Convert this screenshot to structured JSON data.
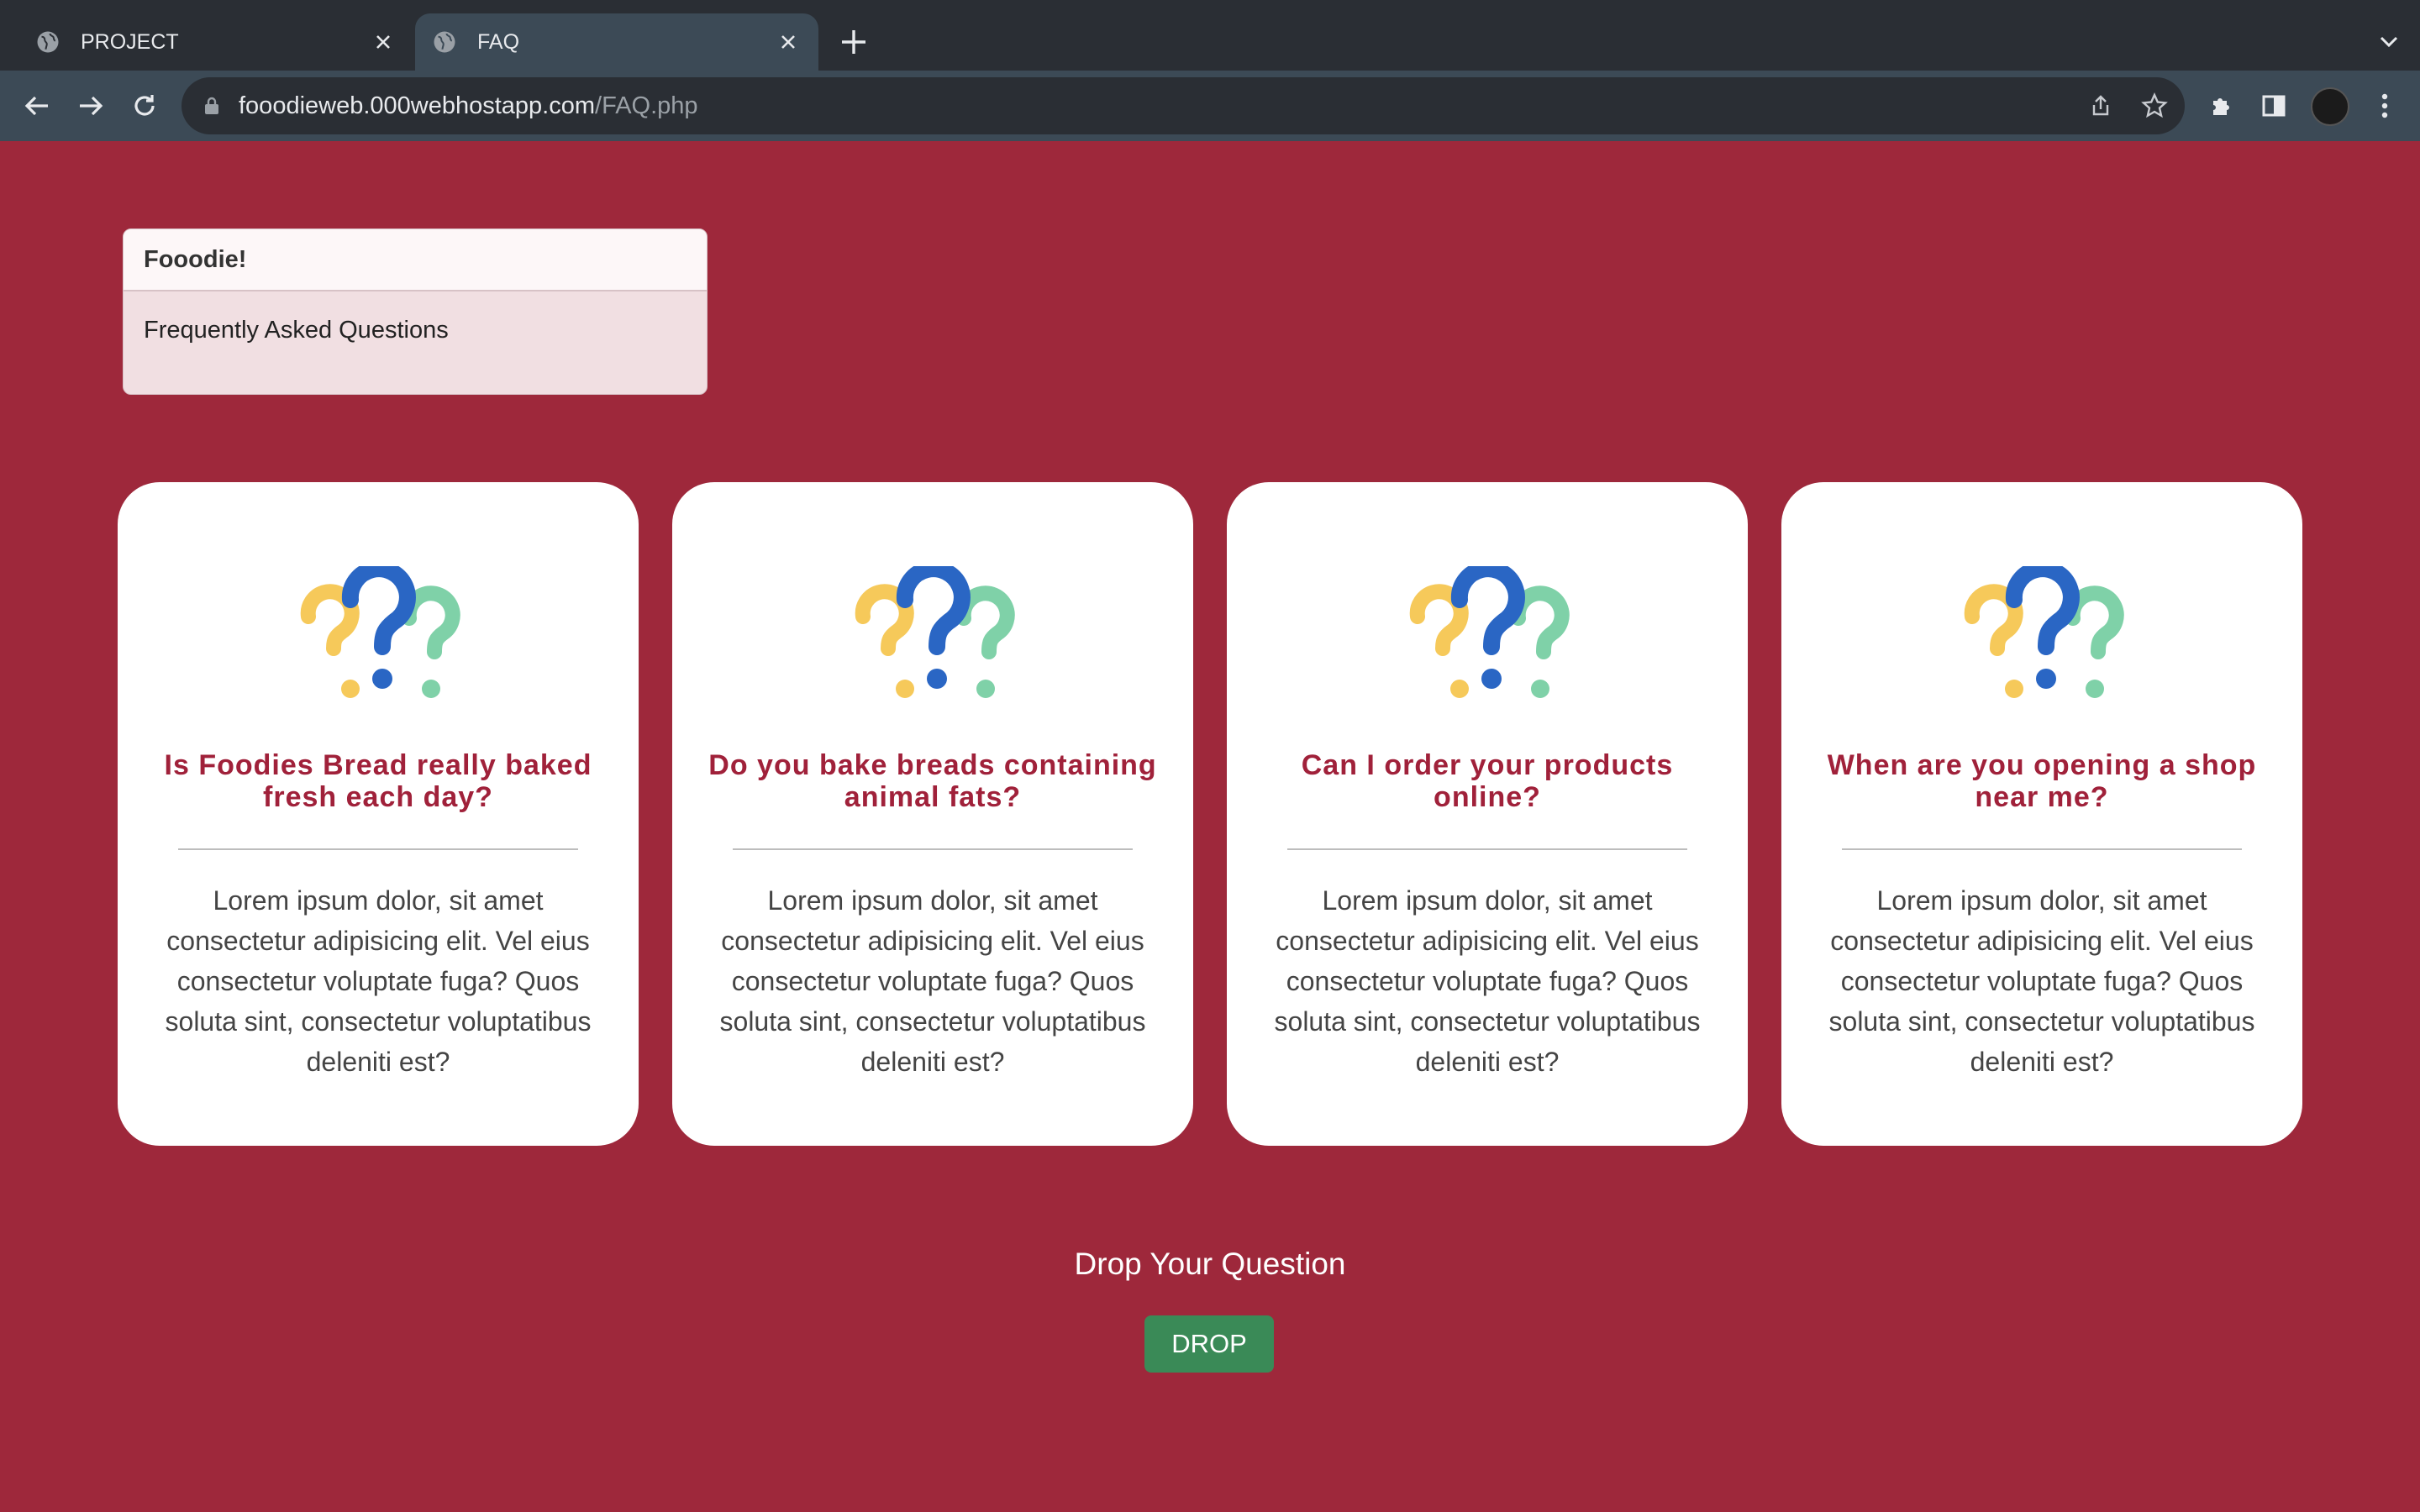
{
  "browser": {
    "tabs": [
      {
        "label": "PROJECT",
        "active": false
      },
      {
        "label": "FAQ",
        "active": true
      }
    ],
    "url_host": "fooodieweb.000webhostapp.com",
    "url_path": "/FAQ.php"
  },
  "brand": {
    "name": "Fooodie!",
    "subtitle": "Frequently Asked Questions"
  },
  "faq": [
    {
      "question": "Is Foodies Bread really baked fresh each day?",
      "answer": "Lorem ipsum dolor, sit amet consectetur adipisicing elit. Vel eius consectetur voluptate fuga? Quos soluta sint, consectetur voluptatibus deleniti est?"
    },
    {
      "question": "Do you bake breads containing animal fats?",
      "answer": "Lorem ipsum dolor, sit amet consectetur adipisicing elit. Vel eius consectetur voluptate fuga? Quos soluta sint, consectetur voluptatibus deleniti est?"
    },
    {
      "question": "Can I order your products online?",
      "answer": "Lorem ipsum dolor, sit amet consectetur adipisicing elit. Vel eius consectetur voluptate fuga? Quos soluta sint, consectetur voluptatibus deleniti est?"
    },
    {
      "question": "When are you opening a shop near me?",
      "answer": "Lorem ipsum dolor, sit amet consectetur adipisicing elit. Vel eius consectetur voluptate fuga? Quos soluta sint, consectetur voluptatibus deleniti est?"
    }
  ],
  "drop": {
    "heading": "Drop Your Question",
    "button_label": "DROP"
  },
  "colors": {
    "page_background": "#9e283b",
    "question_text": "#a0213a",
    "drop_button": "#3a8a57",
    "question_mark_yellow": "#f6c95a",
    "question_mark_blue": "#2a66c4",
    "question_mark_green": "#7fd1a8"
  },
  "icons": [
    "globe-icon",
    "close-icon",
    "plus-icon",
    "chevron-down-icon",
    "back-arrow-icon",
    "forward-arrow-icon",
    "reload-icon",
    "lock-icon",
    "share-icon",
    "star-icon",
    "extensions-icon",
    "sidebar-icon",
    "menu-dots-icon",
    "question-marks-icon"
  ]
}
